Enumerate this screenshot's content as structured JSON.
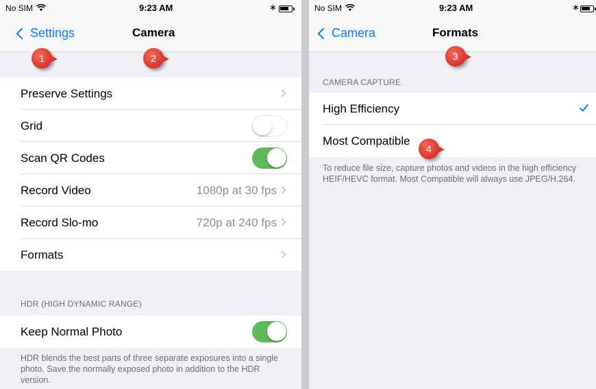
{
  "status_left": {
    "carrier": "No SIM",
    "time": "9:23 AM"
  },
  "status_right": {
    "carrier": "No SIM",
    "time": "9:23 AM"
  },
  "icons": {
    "wifi": "wifi-icon",
    "bluetooth": "bluetooth-icon",
    "battery": "battery-icon",
    "back": "chevron-left-icon",
    "disclosure": "chevron-right-icon",
    "check": "checkmark-icon"
  },
  "colors": {
    "accent": "#0a7bff",
    "toggle_on": "#5fb85a",
    "badge": "#d7352a",
    "grouped_bg": "#efeff4"
  },
  "camera": {
    "back_label": "Settings",
    "title": "Camera",
    "rows": [
      {
        "label": "Preserve Settings",
        "value": ""
      },
      {
        "label": "Grid",
        "toggle": "off"
      },
      {
        "label": "Scan QR Codes",
        "toggle": "on"
      },
      {
        "label": "Record Video",
        "value": "1080p at 30 fps"
      },
      {
        "label": "Record Slo-mo",
        "value": "720p at 240 fps"
      },
      {
        "label": "Formats",
        "value": ""
      }
    ],
    "hdr_header": "HDR (HIGH DYNAMIC RANGE)",
    "hdr_row": {
      "label": "Keep Normal Photo",
      "toggle": "on"
    },
    "hdr_footer": "HDR blends the best parts of three separate exposures into a single photo. Save the normally exposed photo in addition to the HDR version."
  },
  "formats": {
    "back_label": "Camera",
    "title": "Formats",
    "section_header": "CAMERA CAPTURE",
    "options": [
      {
        "label": "High Efficiency",
        "selected": true
      },
      {
        "label": "Most Compatible",
        "selected": false
      }
    ],
    "footer": "To reduce file size, capture photos and videos in the high efficiency HEIF/HEVC format. Most Compatible will always use JPEG/H.264."
  },
  "badges": [
    "1",
    "2",
    "3",
    "4"
  ]
}
